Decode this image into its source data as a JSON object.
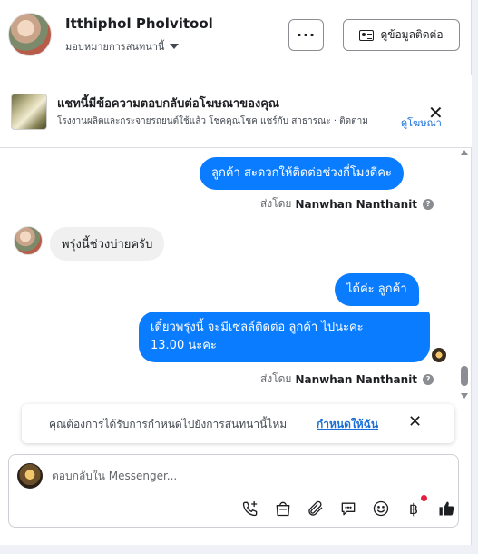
{
  "header": {
    "name": "Itthiphol Pholvitool",
    "subtitle": "มอบหมายการสนทนานี้",
    "more_label": "···",
    "contact_label": "ดูข้อมูลติดต่อ"
  },
  "ad": {
    "title": "แชทนี้มีข้อความตอบกลับต่อโฆษณาของคุณ",
    "description": "โรงงานผลิตและกระจายรถยนต์ใช้แล้ว โชคคุณโชค แชร์กับ สาธารณะ · ติดตาม",
    "link": "ดูโฆษณา"
  },
  "messages": [
    {
      "direction": "out",
      "text": "ลูกค้า สะดวกให้ติดต่อช่วงกี่โมงดีคะ"
    },
    {
      "direction": "in",
      "text": "พรุ่งนี้ช่วงบ่ายครับ"
    },
    {
      "direction": "out",
      "text": "ได้ค่ะ  ลูกค้า"
    },
    {
      "direction": "out",
      "text_line1": "เดี๋ยวพรุ่งนี้ จะมีเซลล์ติดต่อ ลูกค้า  ไปนะคะ",
      "text_line2": "13.00 นะคะ"
    }
  ],
  "sent_by": {
    "prefix": "ส่งโดย",
    "name": "Nanwhan Nanthanit",
    "help": "?"
  },
  "notice": {
    "text": "คุณต้องการได้รับการกำหนดไปยังการสนทนานี้ไหม",
    "link": "กำหนดให้ฉัน"
  },
  "composer": {
    "placeholder": "ตอบกลับใน Messenger...",
    "icons": [
      "call-add-icon",
      "shop-bag-icon",
      "attach-icon",
      "chat-bubble-icon",
      "emoji-icon",
      "baht-icon",
      "like-icon"
    ]
  },
  "colors": {
    "accent": "#0a7cff",
    "link": "#1a6ed8",
    "notification": "#e41e3f"
  }
}
